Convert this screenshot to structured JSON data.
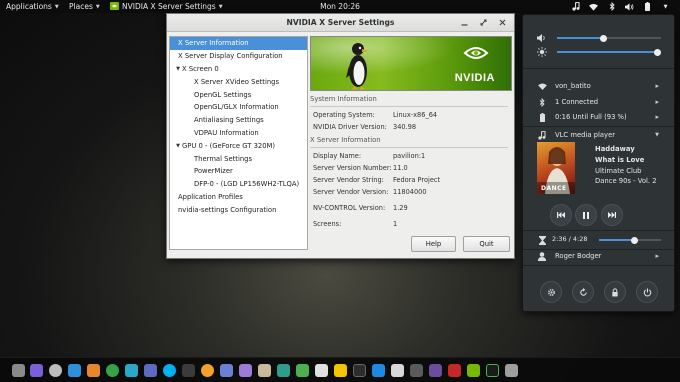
{
  "topbar": {
    "applications_label": "Applications",
    "places_label": "Places",
    "active_app_label": "NVIDIA X Server Settings",
    "clock": "Mon 20:26"
  },
  "window": {
    "title": "NVIDIA X Server Settings",
    "tree": [
      {
        "label": "X Server Information",
        "level": 0,
        "arrow": false,
        "selected": true
      },
      {
        "label": "X Server Display Configuration",
        "level": 0,
        "arrow": false
      },
      {
        "label": "X Screen 0",
        "level": 0,
        "arrow": true
      },
      {
        "label": "X Server XVideo Settings",
        "level": 1,
        "arrow": false
      },
      {
        "label": "OpenGL Settings",
        "level": 1,
        "arrow": false
      },
      {
        "label": "OpenGL/GLX Information",
        "level": 1,
        "arrow": false
      },
      {
        "label": "Antialiasing Settings",
        "level": 1,
        "arrow": false
      },
      {
        "label": "VDPAU Information",
        "level": 1,
        "arrow": false
      },
      {
        "label": "GPU 0 - (GeForce GT 320M)",
        "level": 0,
        "arrow": true
      },
      {
        "label": "Thermal Settings",
        "level": 1,
        "arrow": false
      },
      {
        "label": "PowerMizer",
        "level": 1,
        "arrow": false
      },
      {
        "label": "DFP-0 - (LGD LP156WH2-TLQA)",
        "level": 1,
        "arrow": false
      },
      {
        "label": "Application Profiles",
        "level": 0,
        "arrow": false
      },
      {
        "label": "nvidia-settings Configuration",
        "level": 0,
        "arrow": false
      }
    ],
    "banner_logo_text": "NVIDIA",
    "system_info": {
      "header": "System Information",
      "rows": [
        {
          "label": "Operating System:",
          "value": "Linux-x86_64"
        },
        {
          "label": "NVIDIA Driver Version:",
          "value": "340.98"
        }
      ]
    },
    "xserver_info": {
      "header": "X Server Information",
      "rows": [
        {
          "label": "Display Name:",
          "value": "pavilion:1"
        },
        {
          "label": "Server Version Number:",
          "value": "11.0"
        },
        {
          "label": "Server Vendor String:",
          "value": "Fedora Project"
        },
        {
          "label": "Server Vendor Version:",
          "value": "11804000"
        },
        {
          "label": "NV-CONTROL Version:",
          "value": "1.29"
        },
        {
          "label": "Screens:",
          "value": "1"
        }
      ]
    },
    "help_label": "Help",
    "quit_label": "Quit"
  },
  "system_menu": {
    "volume_level": 0.45,
    "brightness_level": 0.97,
    "wifi_label": "von_batito",
    "bluetooth_label": "1 Connected",
    "battery_label": "0:16 Until Full (93 %)",
    "media_player_label": "VLC media player",
    "artist": "Haddaway",
    "song": "What is Love",
    "album_line1": "Ultimate Club",
    "album_line2": "Dance 90s - Vol. 2",
    "album_art_text": "DANCE",
    "time_label": "2:36 / 4:28",
    "progress_level": 0.58,
    "user_label": "Roger Bodger"
  },
  "colors": {
    "accent": "#4a90d9",
    "nvidia_green": "#76b900",
    "menu_bg": "#2e3436"
  }
}
